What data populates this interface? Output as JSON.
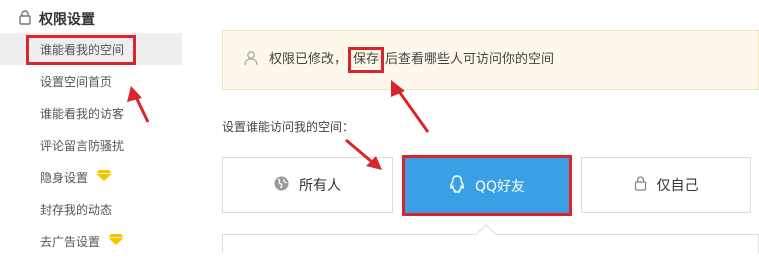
{
  "sidebar": {
    "title": "权限设置",
    "items": [
      {
        "label": "谁能看我的空间",
        "active": true
      },
      {
        "label": "设置空间首页",
        "active": false
      },
      {
        "label": "谁能看我的访客",
        "active": false
      },
      {
        "label": "评论留言防骚扰",
        "active": false
      },
      {
        "label": "隐身设置",
        "active": false,
        "badge": "diamond-icon"
      },
      {
        "label": "封存我的动态",
        "active": false
      },
      {
        "label": "去广告设置",
        "active": false,
        "badge": "diamond-icon"
      }
    ]
  },
  "notice": {
    "text_before": "权限已修改，",
    "highlight": "保存",
    "text_after": "后查看哪些人可访问你的空间"
  },
  "visibility": {
    "label": "设置谁能访问我的空间：",
    "options": [
      {
        "label": "所有人",
        "icon": "globe-icon",
        "selected": false
      },
      {
        "label": "QQ好友",
        "icon": "qq-penguin-icon",
        "selected": true
      },
      {
        "label": "仅自己",
        "icon": "lock-icon",
        "selected": false
      }
    ]
  },
  "colors": {
    "accent": "#3aa0e6",
    "annotation": "#d9262c",
    "notice_bg": "#fdf8ea",
    "gem": "#f5c400"
  }
}
